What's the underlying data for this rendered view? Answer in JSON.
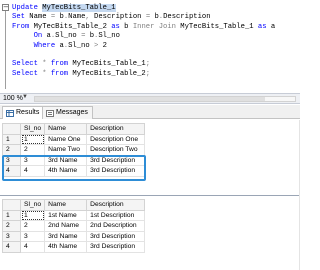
{
  "editor": {
    "lines": [
      [
        {
          "t": "Update ",
          "c": "kw"
        },
        {
          "t": "MyTecBits_Table_1",
          "c": "id sel"
        }
      ],
      [
        {
          "t": "Set ",
          "c": "kw"
        },
        {
          "t": "Name ",
          "c": "id"
        },
        {
          "t": "= ",
          "c": "kwg"
        },
        {
          "t": "b",
          "c": "id"
        },
        {
          "t": ".",
          "c": "kwg"
        },
        {
          "t": "Name",
          "c": "id"
        },
        {
          "t": ", ",
          "c": "kwg"
        },
        {
          "t": "Description ",
          "c": "id"
        },
        {
          "t": "= ",
          "c": "kwg"
        },
        {
          "t": "b",
          "c": "id"
        },
        {
          "t": ".",
          "c": "kwg"
        },
        {
          "t": "Description",
          "c": "id"
        }
      ],
      [
        {
          "t": "From ",
          "c": "kw"
        },
        {
          "t": "MyTecBits_Table_2 ",
          "c": "id"
        },
        {
          "t": "as ",
          "c": "kw"
        },
        {
          "t": "b ",
          "c": "id"
        },
        {
          "t": "Inner Join ",
          "c": "kwg"
        },
        {
          "t": "MyTecBits_Table_1 ",
          "c": "id"
        },
        {
          "t": "as ",
          "c": "kw"
        },
        {
          "t": "a",
          "c": "id"
        }
      ],
      [
        {
          "t": "     On ",
          "c": "kw"
        },
        {
          "t": "a",
          "c": "id"
        },
        {
          "t": ".",
          "c": "kwg"
        },
        {
          "t": "Sl_no ",
          "c": "id"
        },
        {
          "t": "= ",
          "c": "kwg"
        },
        {
          "t": "b",
          "c": "id"
        },
        {
          "t": ".",
          "c": "kwg"
        },
        {
          "t": "Sl_no",
          "c": "id"
        }
      ],
      [
        {
          "t": "     Where ",
          "c": "kw"
        },
        {
          "t": "a",
          "c": "id"
        },
        {
          "t": ".",
          "c": "kwg"
        },
        {
          "t": "Sl_no ",
          "c": "id"
        },
        {
          "t": "> ",
          "c": "kwg"
        },
        {
          "t": "2",
          "c": "id"
        }
      ],
      [
        {
          "t": "",
          "c": "id"
        }
      ],
      [
        {
          "t": "Select ",
          "c": "kw"
        },
        {
          "t": "* ",
          "c": "kwg"
        },
        {
          "t": "from ",
          "c": "kw"
        },
        {
          "t": "MyTecBits_Table_1",
          "c": "id"
        },
        {
          "t": ";",
          "c": "kwg"
        }
      ],
      [
        {
          "t": "Select ",
          "c": "kw"
        },
        {
          "t": "* ",
          "c": "kwg"
        },
        {
          "t": "from ",
          "c": "kw"
        },
        {
          "t": "MyTecBits_Table_2",
          "c": "id"
        },
        {
          "t": ";",
          "c": "kwg"
        }
      ]
    ],
    "fold_symbol": "−"
  },
  "status": {
    "zoom": "100 %",
    "zoom_arrow": "▼"
  },
  "tabs": [
    {
      "label": "Results",
      "icon": "grid-icon",
      "active": true
    },
    {
      "label": "Messages",
      "icon": "messages-icon",
      "active": false
    }
  ],
  "grid1": {
    "columns": [
      "Sl_no",
      "Name",
      "Description"
    ],
    "rows": [
      {
        "rownum": "1",
        "cells": [
          "1",
          "Name One",
          "Description One"
        ]
      },
      {
        "rownum": "2",
        "cells": [
          "2",
          "Name Two",
          "Description Two"
        ]
      },
      {
        "rownum": "3",
        "cells": [
          "3",
          "3rd Name",
          "3rd Description"
        ]
      },
      {
        "rownum": "4",
        "cells": [
          "4",
          "4th Name",
          "3rd Description"
        ]
      }
    ]
  },
  "grid2": {
    "columns": [
      "Sl_no",
      "Name",
      "Description"
    ],
    "rows": [
      {
        "rownum": "1",
        "cells": [
          "1",
          "1st Name",
          "1st Description"
        ]
      },
      {
        "rownum": "2",
        "cells": [
          "2",
          "2nd Name",
          "2nd Description"
        ]
      },
      {
        "rownum": "3",
        "cells": [
          "3",
          "3rd Name",
          "3rd Description"
        ]
      },
      {
        "rownum": "4",
        "cells": [
          "4",
          "4th Name",
          "3rd Description"
        ]
      }
    ]
  },
  "colors": {
    "highlight": "#2e8dd6",
    "keyword": "#0000ff",
    "operator": "#808080",
    "selection": "#c5d9f1"
  }
}
